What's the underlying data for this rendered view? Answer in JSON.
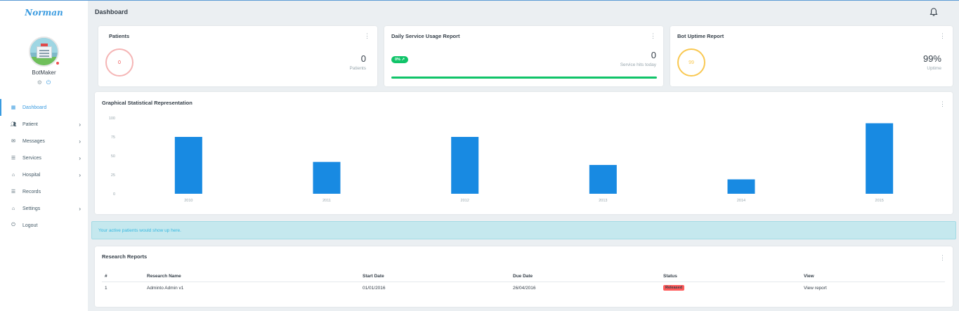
{
  "brand": "Norman",
  "user": {
    "name": "BotMaker"
  },
  "header": {
    "title": "Dashboard"
  },
  "menu": [
    {
      "label": "Dashboard",
      "icon": "dashboard-icon",
      "active": true,
      "chevron": false
    },
    {
      "label": "Patient",
      "icon": "users-icon",
      "active": false,
      "chevron": true
    },
    {
      "label": "Messages",
      "icon": "mail-icon",
      "active": false,
      "chevron": true
    },
    {
      "label": "Services",
      "icon": "list-icon",
      "active": false,
      "chevron": true
    },
    {
      "label": "Hospital",
      "icon": "hospital-icon",
      "active": false,
      "chevron": true
    },
    {
      "label": "Records",
      "icon": "list-icon",
      "active": false,
      "chevron": false
    },
    {
      "label": "Settings",
      "icon": "settings-icon",
      "active": false,
      "chevron": true
    },
    {
      "label": "Logout",
      "icon": "power-icon",
      "active": false,
      "chevron": false
    }
  ],
  "cards": {
    "patients": {
      "title": "Patients",
      "ring_value": "0",
      "value": "0",
      "label": "Patients"
    },
    "usage": {
      "title": "Daily Service Usage Report",
      "pill": "0% ↗",
      "value": "0",
      "label": "Service hits today",
      "progress": 1.0
    },
    "uptime": {
      "title": "Bot Uptime Report",
      "ring_value": "99",
      "value": "99%",
      "label": "Uptime",
      "percent": 99
    }
  },
  "chart_section": {
    "title": "Graphical Statistical Representation"
  },
  "chart_data": {
    "type": "bar",
    "categories": [
      "2010",
      "2011",
      "2012",
      "2013",
      "2014",
      "2015"
    ],
    "values": [
      75,
      42,
      75,
      38,
      19,
      93
    ],
    "title": "",
    "xlabel": "",
    "ylabel": "",
    "ylim": [
      0,
      100
    ],
    "yticks": [
      "0",
      "25",
      "50",
      "75",
      "100"
    ],
    "color": "#188ae2",
    "grid": false
  },
  "alert": {
    "text": "Your active patients would show up here."
  },
  "research": {
    "title": "Research Reports",
    "columns": [
      "#",
      "Research Name",
      "Start Date",
      "Due Date",
      "Status",
      "View"
    ],
    "rows": [
      {
        "num": "1",
        "name": "Adminto Admin v1",
        "start": "01/01/2016",
        "due": "26/04/2016",
        "status": "Released",
        "view": "View report"
      }
    ]
  },
  "colors": {
    "accent": "#3a9be0",
    "success": "#10c469",
    "danger": "#ff5b5b",
    "warning": "#f9c851",
    "pink": "#f5b5b5",
    "bar": "#188ae2"
  }
}
